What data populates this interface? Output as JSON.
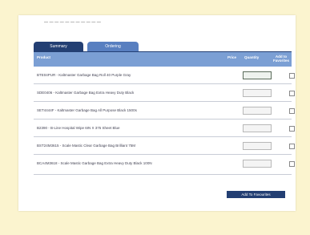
{
  "header": {
    "top_text": "— — — — — — — — — — —"
  },
  "tabs": [
    {
      "label": "Summary"
    },
    {
      "label": "Ordering"
    }
  ],
  "table": {
    "headers": {
      "product": "Product",
      "price": "Price",
      "quantity": "Quantity",
      "compare": "Add to Favorites"
    },
    "rows": [
      {
        "name": "BTE04PUR - Kaltmaster Garbage Bag Roll 40 Purple Gray"
      },
      {
        "name": "SDE0406 - Kaltmaster Garbage Bag Extra Heavy Duty Black"
      },
      {
        "name": "SET4444F - Kaltmaster Garbage Bag All Purpose Black 1500s"
      },
      {
        "name": "B2390 - B-Line Hospital Wipe 6IN X 375 Sheet Blue"
      },
      {
        "name": "BST24M3615 - Scale Mastic Clear Garbage Bag Brilliant 75M"
      },
      {
        "name": "BCA4M3618 - Scale Mastic Garbage Bag Extra Heavy Duty Black 100N"
      }
    ]
  },
  "actions": {
    "add_favorites": "Add To Favourites"
  }
}
